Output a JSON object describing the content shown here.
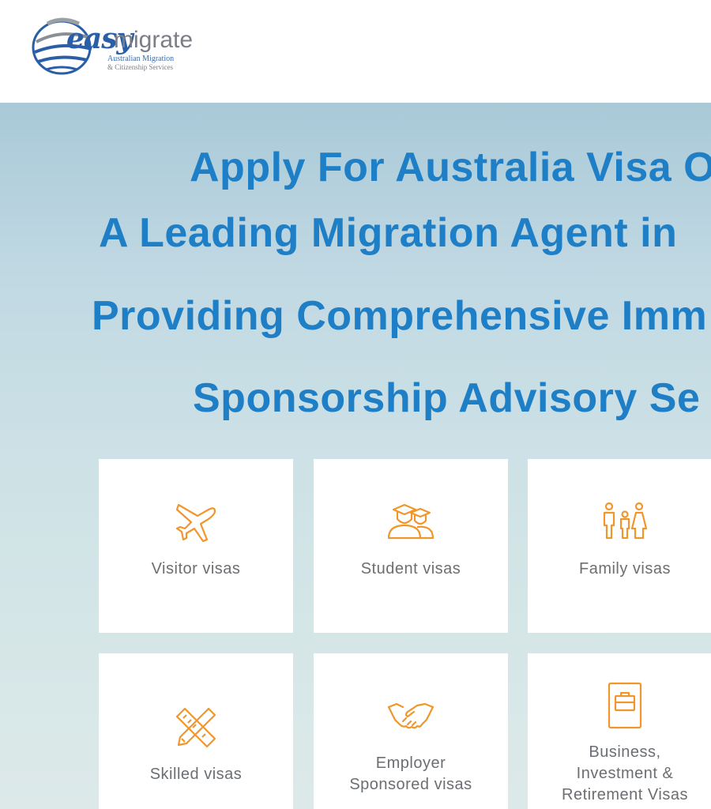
{
  "logo": {
    "word_easy": "easy",
    "word_migrate": "migrate",
    "subtitle_line1": "Australian Migration",
    "subtitle_line2": "& Citizenship Services"
  },
  "hero": {
    "headline_lines": [
      "Apply For Australia Visa O",
      "A Leading Migration Agent in",
      "Providing Comprehensive Imm",
      "Sponsorship Advisory Se"
    ]
  },
  "cards": [
    {
      "label": "Visitor visas",
      "icon": "airplane-icon"
    },
    {
      "label": "Student visas",
      "icon": "graduates-icon"
    },
    {
      "label": "Family visas",
      "icon": "family-icon"
    },
    {
      "label": "Skilled visas",
      "icon": "pencil-ruler-icon"
    },
    {
      "label": "Employer\nSponsored visas",
      "icon": "handshake-icon"
    },
    {
      "label": "Business,\nInvestment &\nRetirement Visas",
      "icon": "briefcase-icon"
    }
  ],
  "colors": {
    "headline_blue": "#1f7fc6",
    "icon_orange": "#f0962b",
    "card_text": "#6b6e72",
    "logo_blue": "#2a5fa8"
  }
}
